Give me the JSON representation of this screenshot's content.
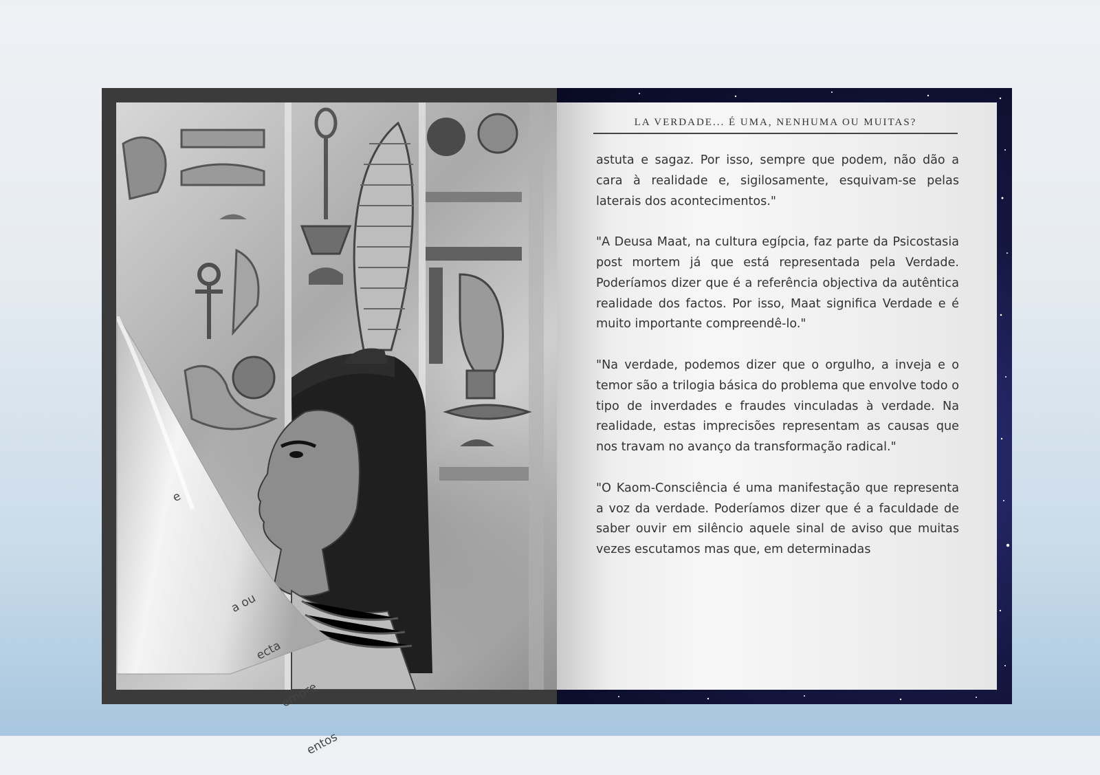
{
  "book": {
    "running_head": "LA VERDADE... É UMA, NENHUMA OU MUITAS?",
    "paragraphs": [
      "astuta e sagaz. Por isso, sempre que podem, não dão a cara à realidade e, sigilosamente, esquivam-se pelas laterais dos acontecimentos.\"",
      "\"A Deusa Maat, na cultura egípcia, faz parte da Psicostasia post mortem já que está representada pela Verdade. Poderíamos dizer que é a referência objectiva da autêntica realidade dos factos. Por isso, Maat significa Verdade e é muito importante compreendê-lo.\"",
      "\"Na verdade, podemos dizer que o orgulho, a inveja e o temor são a trilogia básica do problema que envolve todo o tipo de inverdades e fraudes vinculadas à verdade. Na realidade, estas imprecisões representam as causas que nos travam no avanço da transformação radical.\"",
      "\"O Kaom-Consciência é uma manifestação que representa a voz da verdade. Poderíamos dizer que é a faculdade de saber ouvir em silêncio aquele sinal de aviso que muitas vezes escutamos mas que, em determinadas"
    ],
    "curl_text_lines": [
      "e",
      "",
      "",
      "a ou",
      "ecta",
      "empre",
      "entos"
    ]
  },
  "colors": {
    "frame": "#3b3b3b",
    "paper": "#f2f2f2",
    "space": "#14163f",
    "text": "#333333"
  },
  "icons": {
    "page_curl": "page-curl-icon"
  }
}
